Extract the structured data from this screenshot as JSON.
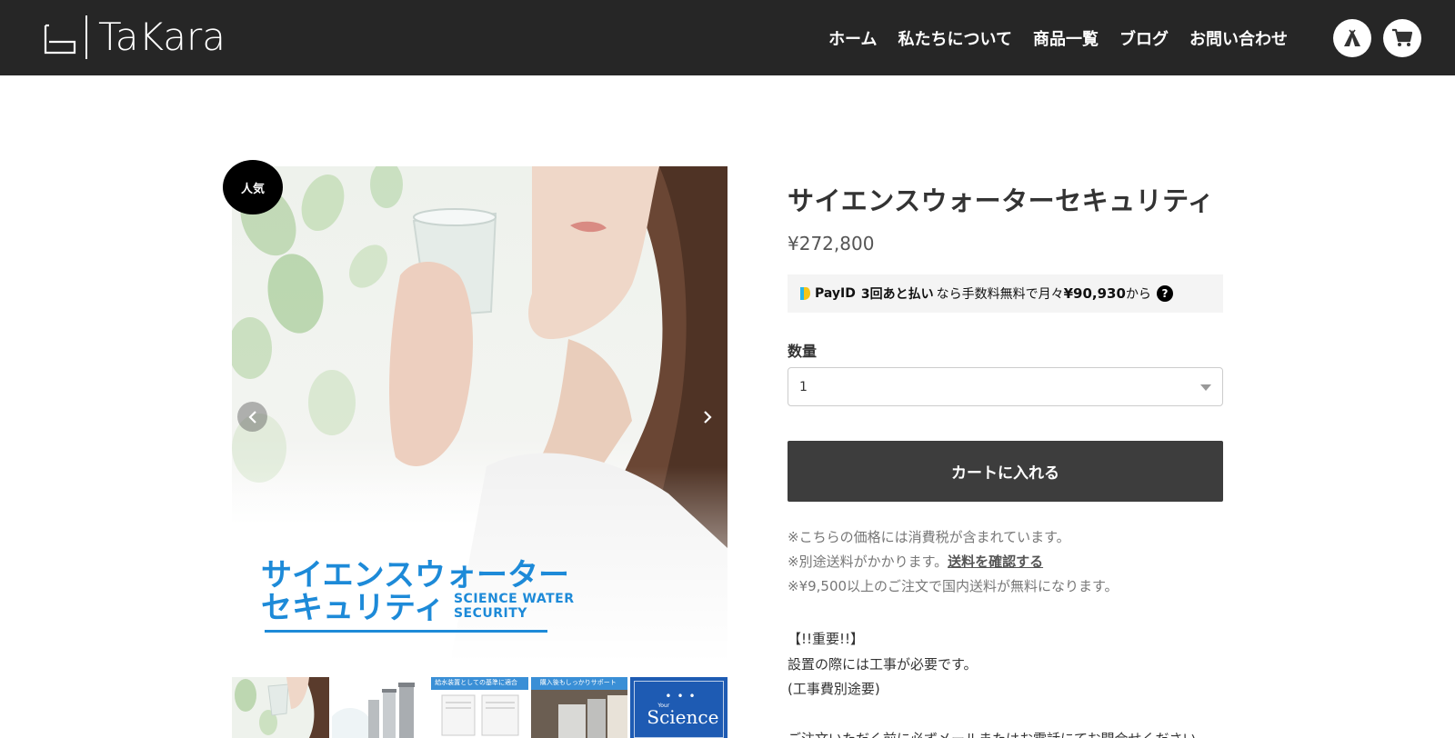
{
  "header": {
    "logo_text": "TaKara",
    "nav": [
      "ホーム",
      "私たちについて",
      "商品一覧",
      "ブログ",
      "お問い合わせ"
    ],
    "icons": [
      "tent-icon",
      "cart-icon"
    ]
  },
  "gallery": {
    "badge": "人気",
    "image_title_line1": "サイエンスウォーター",
    "image_title_line2": "セキュリティ",
    "image_title_en_line1": "SCIENCE WATER",
    "image_title_en_line2": "SECURITY",
    "thumb_captions": [
      "給水装置としての基準に適合",
      "購入後もしっかりサポート"
    ],
    "thumb5_text": "Science",
    "thumb5_small": "Your"
  },
  "product": {
    "title": "サイエンスウォーターセキュリティ",
    "price": "¥272,800",
    "payid": {
      "brand": "PayID",
      "plan": "3回あと払い",
      "text_mid": "なら手数料無料で月々",
      "amount": "¥90,930",
      "text_end": "から",
      "help": "?"
    },
    "quantity_label": "数量",
    "quantity_value": "1",
    "add_to_cart": "カートに入れる",
    "notes": [
      "※こちらの価格には消費税が含まれています。",
      "※別途送料がかかります。",
      "※¥9,500以上のご注文で国内送料が無料になります。"
    ],
    "shipping_link": "送料を確認する",
    "important_lines": [
      "【!!重要!!】",
      "設置の際には工事が必要です。",
      "(工事費別途要)",
      "",
      "ご注文いただく前に必ずメールまたはお電話にてお問合せください"
    ]
  },
  "colors": {
    "header_bg": "#262626",
    "accent_blue": "#1d8ad8",
    "cart_button": "#3d3d3d"
  }
}
